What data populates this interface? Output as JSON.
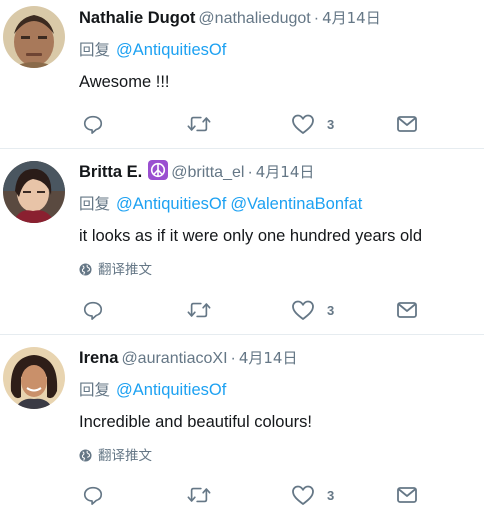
{
  "reply_label": "回复",
  "translate_label": "翻译推文",
  "tweets": [
    {
      "name": "Nathalie Dugot",
      "handle": "@nathaliedugot",
      "separator": "·",
      "date": "4月14日",
      "mentions": [
        "@AntiquitiesOf"
      ],
      "text": "Awesome !!!",
      "likes": "3"
    },
    {
      "name": "Britta E.",
      "handle": "@britta_el",
      "separator": "·",
      "date": "4月14日",
      "mentions": [
        "@AntiquitiesOf",
        "@ValentinaBonfat"
      ],
      "text": "it looks as if it were only one hundred years old",
      "likes": "3"
    },
    {
      "name": "Irena",
      "handle": "@aurantiacoXI",
      "separator": "·",
      "date": "4月14日",
      "mentions": [
        "@AntiquitiesOf"
      ],
      "text": "Incredible and beautiful colours!",
      "likes": "3"
    }
  ],
  "colors": {
    "link": "#1da1f2",
    "secondary_text": "#657786",
    "primary_text": "#14171a",
    "divider": "#e6ecf0",
    "badge": "#9a4fd0"
  },
  "icons": [
    "reply-icon",
    "retweet-icon",
    "heart-icon",
    "direct-message-icon",
    "globe-icon",
    "peace-sign-icon"
  ]
}
